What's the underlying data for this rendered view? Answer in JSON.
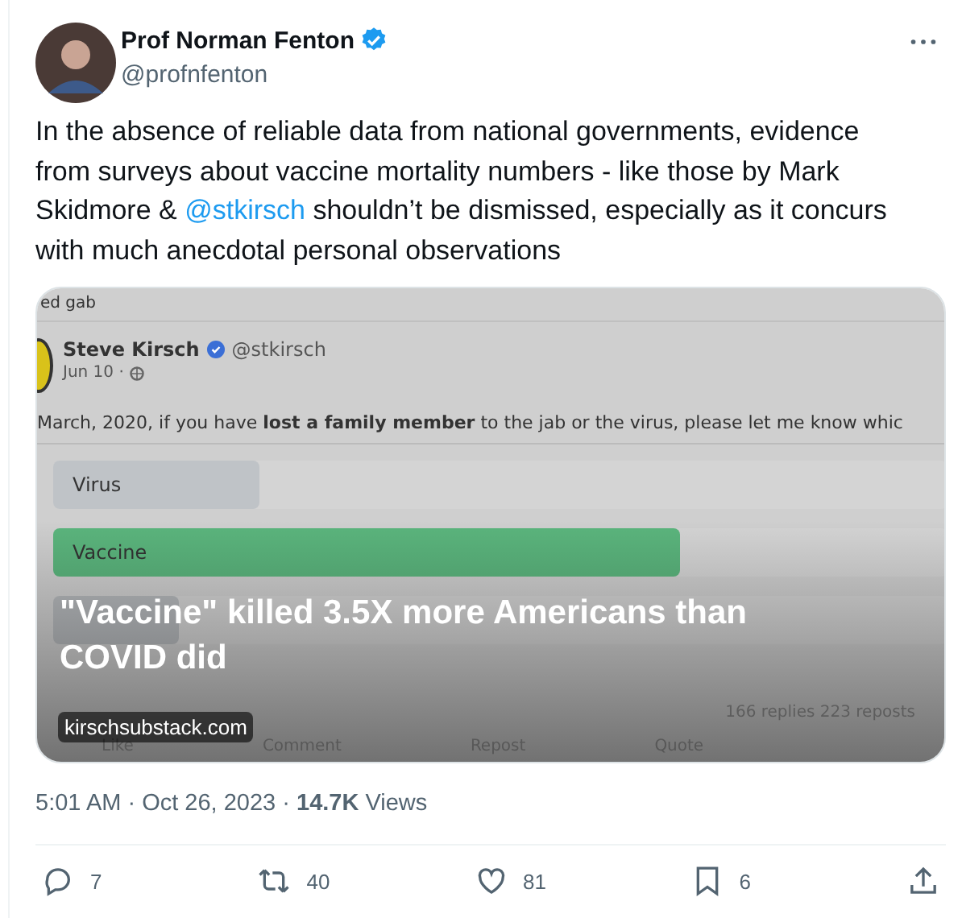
{
  "author": {
    "name": "Prof Norman Fenton",
    "handle": "@profnfenton",
    "verified": true
  },
  "text_parts": [
    {
      "kind": "text",
      "text": "In the absence of reliable data from national governments, evidence from surveys about vaccine mortality numbers - like those by Mark Skidmore & "
    },
    {
      "kind": "mention",
      "text": "@stkirsch"
    },
    {
      "kind": "text",
      "text": " shouldn’t be dismissed, especially as it concurs with much anecdotal personal observations"
    }
  ],
  "card": {
    "image": {
      "kind": "screenshot",
      "source_label": "ed gab",
      "author": "Steve Kirsch",
      "verified": true,
      "handle": "@stkirsch",
      "date": "Jun 10 ·",
      "question": "March, 2020, if you have **lost a family member** to the jab or the virus, please let me know whic",
      "poll": [
        {
          "label": "Virus",
          "level": 0.23,
          "color": "#bfc3c7"
        },
        {
          "label": "Vaccine",
          "level": 0.7,
          "color": "#5bb57d"
        },
        {
          "level": 0.14
        }
      ],
      "stats": "166 replies  223 reposts",
      "actions": [
        "Like",
        "Comment",
        "Repost",
        "Quote"
      ]
    },
    "title": "\"Vaccine\" killed 3.5X more Americans than COVID did",
    "domain": "kirschsubstack.com"
  },
  "meta": "5:01 AM · Oct 26, 2023 · **14.7K** Views",
  "actions": [
    {
      "kind": "reply",
      "count": "7"
    },
    {
      "kind": "repost",
      "count": "40"
    },
    {
      "kind": "like",
      "count": "81"
    },
    {
      "kind": "bookmark",
      "count": "6"
    },
    {
      "kind": "share"
    }
  ]
}
